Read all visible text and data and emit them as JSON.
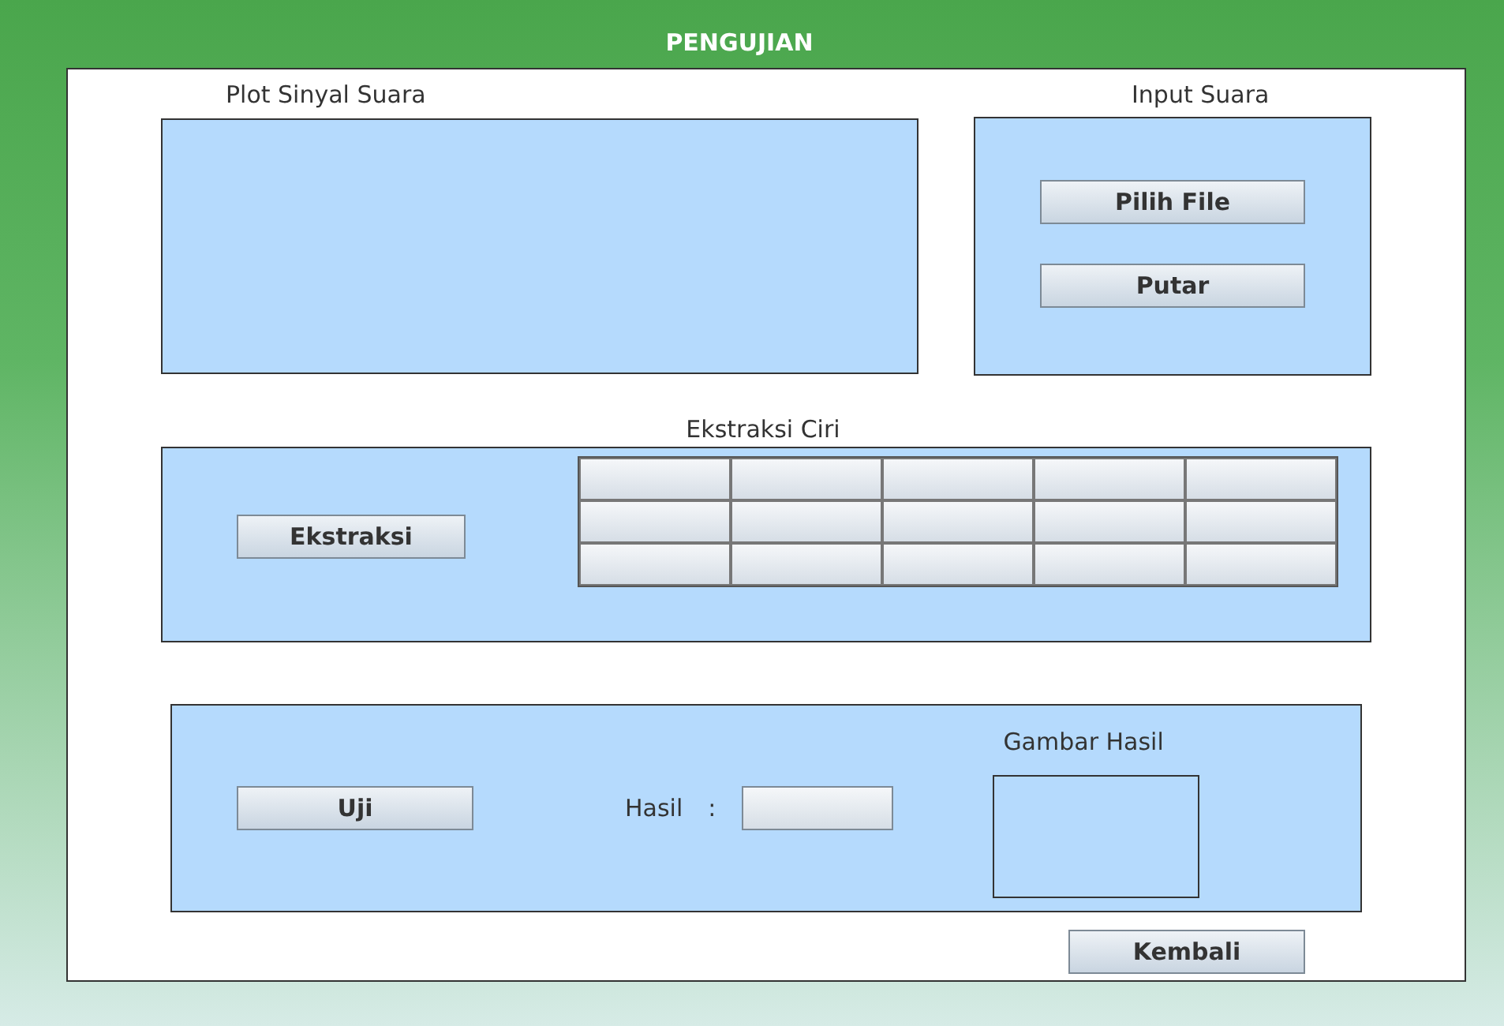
{
  "window": {
    "title": "PENGUJIAN"
  },
  "plot": {
    "label": "Plot Sinyal Suara"
  },
  "input": {
    "label": "Input Suara",
    "buttons": [
      "Pilih File",
      "Putar"
    ]
  },
  "extraction": {
    "label": "Ekstraksi Ciri",
    "button": "Ekstraksi"
  },
  "test": {
    "button": "Uji",
    "result_label": "Hasil",
    "separator": ":",
    "image_label": "Gambar Hasil"
  },
  "footer": {
    "button": "Kembali"
  }
}
